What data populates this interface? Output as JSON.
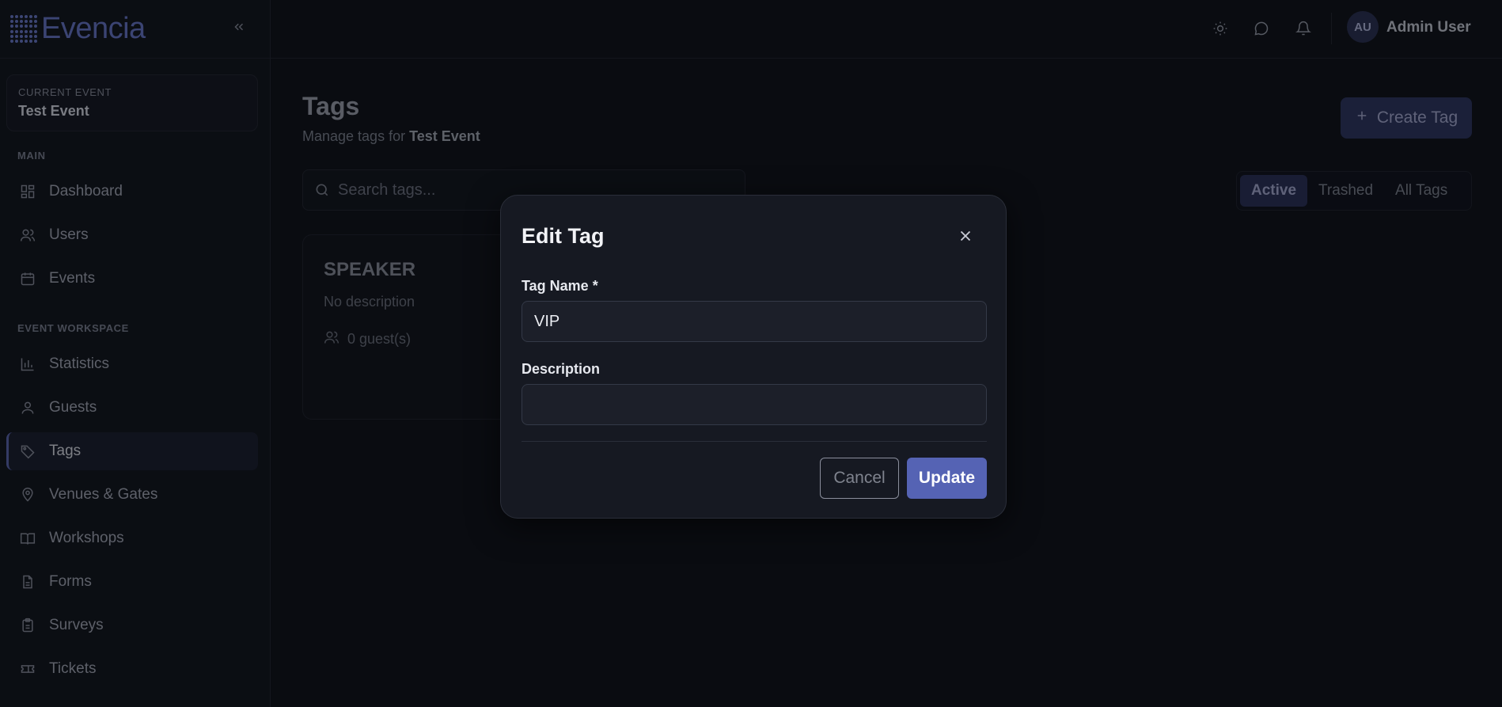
{
  "brand": {
    "name": "Evencia"
  },
  "sidebar": {
    "current_event_label": "CURRENT EVENT",
    "current_event_name": "Test Event",
    "sections": [
      {
        "label": "MAIN"
      },
      {
        "label": "EVENT WORKSPACE"
      }
    ],
    "items": [
      {
        "label": "Dashboard",
        "icon": "dashboard-icon"
      },
      {
        "label": "Users",
        "icon": "users-icon"
      },
      {
        "label": "Events",
        "icon": "calendar-icon"
      },
      {
        "label": "Statistics",
        "icon": "bar-chart-icon"
      },
      {
        "label": "Guests",
        "icon": "user-icon"
      },
      {
        "label": "Tags",
        "icon": "tag-icon",
        "active": true
      },
      {
        "label": "Venues & Gates",
        "icon": "map-pin-icon"
      },
      {
        "label": "Workshops",
        "icon": "book-icon"
      },
      {
        "label": "Forms",
        "icon": "file-icon"
      },
      {
        "label": "Surveys",
        "icon": "clipboard-icon"
      },
      {
        "label": "Tickets",
        "icon": "ticket-icon"
      }
    ]
  },
  "topbar": {
    "avatar_initials": "AU",
    "user_name": "Admin User"
  },
  "page": {
    "title": "Tags",
    "subtitle_prefix": "Manage tags for",
    "subtitle_event": "Test Event",
    "create_button": "Create Tag",
    "search_placeholder": "Search tags...",
    "filters": [
      {
        "label": "Active",
        "active": true
      },
      {
        "label": "Trashed"
      },
      {
        "label": "All Tags"
      }
    ],
    "tag_card": {
      "name": "SPEAKER",
      "description": "No description",
      "guests": "0 guest(s)"
    }
  },
  "modal": {
    "title": "Edit Tag",
    "name_label": "Tag Name *",
    "name_value": "VIP",
    "description_label": "Description",
    "description_value": "",
    "cancel_label": "Cancel",
    "update_label": "Update"
  },
  "colors": {
    "accent": "#5563b4",
    "background": "#0f1117",
    "brand": "#6877c9"
  }
}
